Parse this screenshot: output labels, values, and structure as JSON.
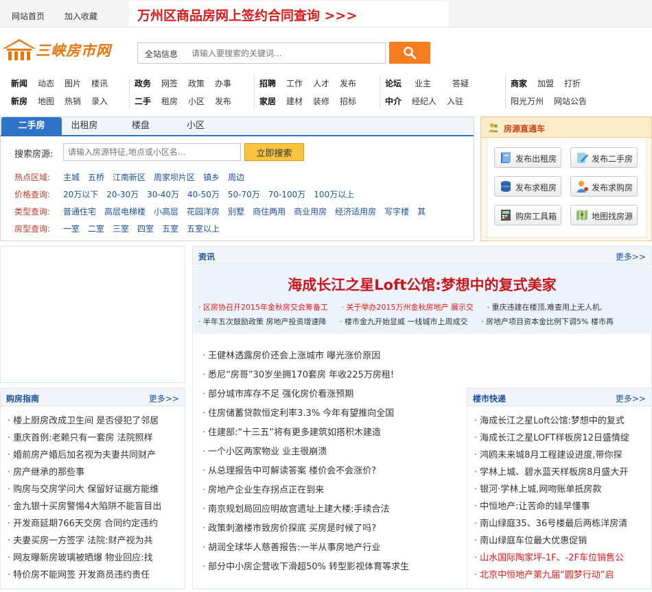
{
  "topbar": {
    "home": "网站首页",
    "favorite": "加入收藏",
    "banner": "万州区商品房网上签约合同查询 >>>"
  },
  "logo": {
    "text": "三峡房市网"
  },
  "search": {
    "scope": "全站信息",
    "placeholder": "请输入要搜索的关键词..."
  },
  "nav": [
    {
      "row1": [
        "新闻",
        "动态",
        "图片",
        "楼讯"
      ],
      "row2": [
        "新房",
        "地图",
        "热销",
        "录入"
      ]
    },
    {
      "row1": [
        "政务",
        "网签",
        "政策",
        "办事"
      ],
      "row2": [
        "二手",
        "租房",
        "小区",
        "发布"
      ]
    },
    {
      "row1": [
        "招聘",
        "工作",
        "人才",
        "发布"
      ],
      "row2": [
        "家居",
        "建材",
        "装修",
        "招标"
      ]
    },
    {
      "row1": [
        "论坛",
        "业主",
        "答疑"
      ],
      "row2": [
        "中介",
        "经纪人",
        "入驻"
      ]
    },
    {
      "row1": [
        "商家",
        "加盟",
        "打折"
      ],
      "row2": [
        "阳光万州",
        "网站公告"
      ]
    }
  ],
  "house_search": {
    "tabs": [
      "二手房",
      "出租房",
      "楼盘",
      "小区"
    ],
    "label": "搜索房源:",
    "placeholder": "请输入房源特征,地点或小区名...",
    "button": "立即搜索",
    "filters": [
      {
        "label": "热点区域:",
        "items": [
          "主城",
          "五桥",
          "江南新区",
          "周家坝片区",
          "镇乡",
          "周边"
        ]
      },
      {
        "label": "价格查询:",
        "items": [
          "20万以下",
          "20-30万",
          "30-40万",
          "40-50万",
          "50-70万",
          "70-100万",
          "100万以上"
        ]
      },
      {
        "label": "类型查询:",
        "items": [
          "普通住宅",
          "高层电梯楼",
          "小高层",
          "花园洋房",
          "别墅",
          "商住两用",
          "商业用房",
          "经济适用房",
          "写字楼",
          "其"
        ]
      },
      {
        "label": "房型查询:",
        "items": [
          "一室",
          "二室",
          "三室",
          "四室",
          "五室",
          "五室以上"
        ]
      }
    ]
  },
  "direct": {
    "title": "房源直通车",
    "buttons": [
      "发布出租房",
      "发布二手房",
      "发布求租房",
      "发布求购房",
      "购房工具箱",
      "地图找房源"
    ]
  },
  "guide": {
    "title": "购房指南",
    "more": "更多>>",
    "items": [
      "楼上厨房改成卫生间 是否侵犯了邻居",
      "重庆首例:老赖只有一套房 法院照样",
      "婚前房产婚后加名视为夫妻共同财产",
      "房产继承的那些事",
      "购房与交房学问大 保留好证据方能维",
      "金九银十买房警惕4大陷阱不能盲目出",
      "开发商延期766天交房 合同约定违约",
      "夫妻买房一方签字 法院:财产视为共",
      "网友曝新房玻璃被晒爆 物业回应:找",
      "特价房不能网签 开发商员违约责任"
    ]
  },
  "news": {
    "title": "资讯",
    "more": "更多>>",
    "headline": "海成长江之星Loft公馆:梦想中的复式美家",
    "sub1": [
      "区房协召开2015年金秋房交会筹备工",
      "关于举办2015万州金秋房地产 展示交",
      "重庆违建在楼顶,难查用上无人机,"
    ],
    "sub2": [
      "半年五次鼓励政策 房地产投资增速降",
      "楼市金九开始显威 一线城市上周成交",
      "房地产项目资本金比例下调5% 楼市再"
    ],
    "items": [
      "王健林透露房价还会上涨城市 曝光涨价原因",
      "悉尼“房哥”30岁坐拥170套房 年收225万房租!",
      "部分城市库存不足 强化房价看涨预期",
      "住房储蓄贷款恒定利率3.3% 今年有望推向全国",
      "住建部:“十三五”将有更多建筑如搭积木建造",
      "一个小区两家物业 业主很崩溃",
      "从总理报告中可解读答案 楼价会不会涨价?",
      "房地产企业生存拐点正在到来",
      "南京规划局回应明故宫遗址上建大楼:手续合法",
      "政策刺激楼市致房价探底 买房是时候了吗?",
      "胡润全球华人慈善报告:一半从事房地产行业",
      "部分中小房企营收下滑超50% 转型影视体育等求生"
    ]
  },
  "market": {
    "title": "楼市快递",
    "more": "更多>>",
    "items": [
      {
        "text": "海成长江之星Loft公馆:梦想中的复式",
        "red": false
      },
      {
        "text": "海成长江之星LOFT样板房12日盛情绽",
        "red": false
      },
      {
        "text": "鸿鸥未来城8月工程建设进度,带你探",
        "red": false
      },
      {
        "text": "学林上城、碧水蓝天样板房8月盛大开",
        "red": false
      },
      {
        "text": "银河·学林上城,网吻账单抵房款",
        "red": false
      },
      {
        "text": "中恒地产:让苦命的娃早懂事",
        "red": false
      },
      {
        "text": "南山绿庭35、36号楼最后两栋洋房清",
        "red": false
      },
      {
        "text": "南山绿庭车位最大优惠促销",
        "red": false
      },
      {
        "text": "山水国际陶家坪-1F、-2F车位销售公",
        "red": true
      },
      {
        "text": "北京中恒地产第九届“圆梦行动”启",
        "red": true
      }
    ]
  }
}
